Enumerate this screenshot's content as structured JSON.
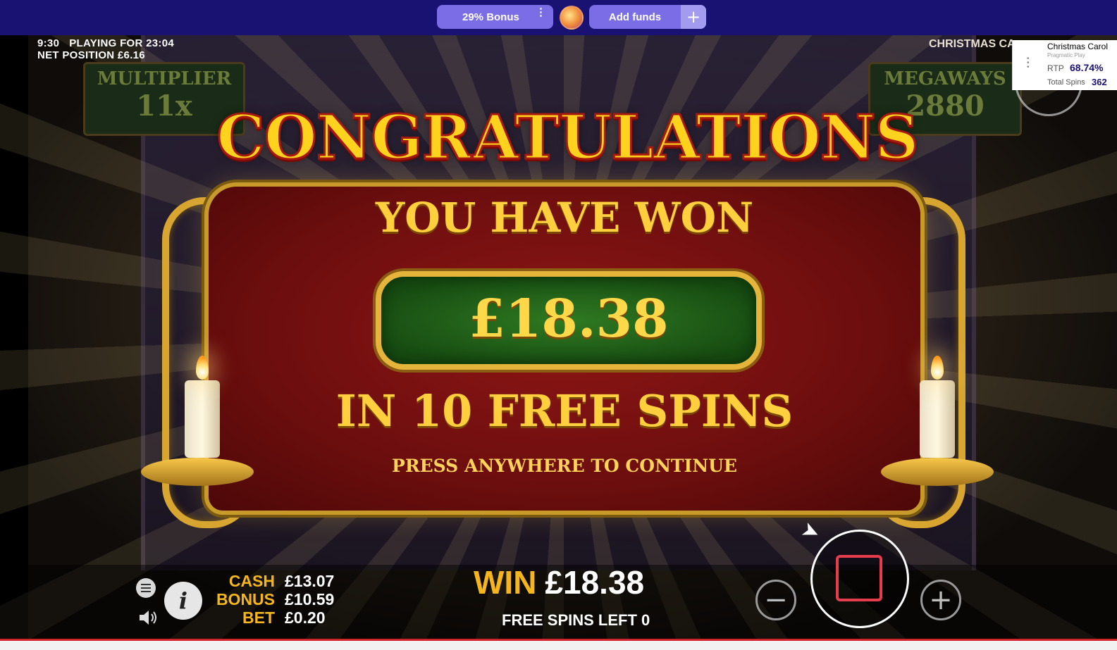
{
  "topbar": {
    "bonus_label": "29% Bonus",
    "add_funds_label": "Add funds"
  },
  "hud": {
    "clock": "9:30",
    "playing_for": "PLAYING FOR 23:04",
    "net_position": "NET POSITION £6.16",
    "game_title_partial": "CHRISTMAS CA"
  },
  "reel_panels": {
    "multiplier_label": "MULTIPLIER",
    "multiplier_value": "11x",
    "megaways_label": "MEGAWAYS",
    "megaways_value": "2880"
  },
  "rtp_widget": {
    "game_name": "Christmas Carol",
    "provider": "Pragmatic Play",
    "rtp_label": "RTP",
    "rtp_value": "68.74%",
    "total_spins_label": "Total Spins",
    "total_spins_value": "362"
  },
  "popup": {
    "headline": "CONGRATULATIONS",
    "you_have_won": "YOU HAVE WON",
    "amount": "£18.38",
    "free_spins_text": "IN 10 FREE SPINS",
    "press_text": "PRESS ANYWHERE TO CONTINUE"
  },
  "stats": {
    "cash_label": "CASH",
    "cash_value": "£13.07",
    "bonus_label": "BONUS",
    "bonus_value": "£10.59",
    "bet_label": "BET",
    "bet_value": "£0.20"
  },
  "win": {
    "label": "WIN",
    "value": "£18.38",
    "free_spins_left": "FREE SPINS LEFT 0"
  },
  "colors": {
    "topbar": "#1a1272",
    "pill": "#7a6de6",
    "gold": "#f5b51c",
    "popup_red": "#8e1616",
    "amount_green": "#2f7a22",
    "stop_red": "#e63d4c"
  },
  "icons": {
    "menu": "hamburger-icon",
    "info": "info-icon",
    "sound": "speaker-icon",
    "minus": "minus-icon",
    "plus": "plus-icon",
    "stop": "stop-icon"
  }
}
